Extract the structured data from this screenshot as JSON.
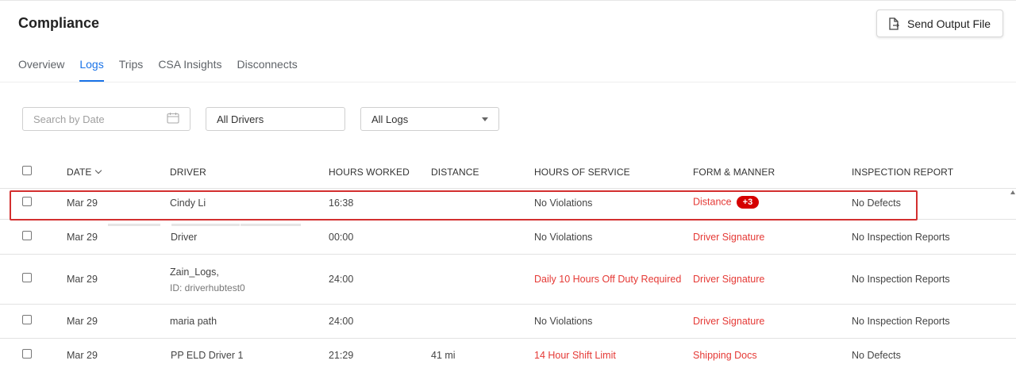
{
  "page": {
    "title": "Compliance",
    "send_button_label": "Send Output File"
  },
  "tabs": [
    {
      "label": "Overview",
      "active": false
    },
    {
      "label": "Logs",
      "active": true
    },
    {
      "label": "Trips",
      "active": false
    },
    {
      "label": "CSA Insights",
      "active": false
    },
    {
      "label": "Disconnects",
      "active": false
    }
  ],
  "filters": {
    "date_placeholder": "Search by Date",
    "drivers_value": "All Drivers",
    "logs_value": "All Logs"
  },
  "table": {
    "headers": {
      "date": "DATE",
      "driver": "DRIVER",
      "hours_worked": "HOURS WORKED",
      "distance": "DISTANCE",
      "hours_of_service": "HOURS OF SERVICE",
      "form_manner": "FORM & MANNER",
      "inspection_report": "INSPECTION REPORT"
    },
    "rows": [
      {
        "date": "Mar 29",
        "driver": "Cindy Li",
        "driver_sub": "",
        "hours": "16:38",
        "distance": "",
        "hos": "No Violations",
        "form": "Distance",
        "form_badge": "+3",
        "inspection": "No Defects"
      },
      {
        "date": "Mar 29",
        "driver": "Driver",
        "driver_sub": "",
        "hours": "00:00",
        "distance": "",
        "hos": "No Violations",
        "form": "Driver Signature",
        "form_badge": "",
        "inspection": "No Inspection Reports"
      },
      {
        "date": "Mar 29",
        "driver": "Zain_Logs,",
        "driver_sub": "ID: driverhubtest0",
        "hours": "24:00",
        "distance": "",
        "hos": "Daily 10 Hours Off Duty Required",
        "form": "Driver Signature",
        "form_badge": "",
        "inspection": "No Inspection Reports"
      },
      {
        "date": "Mar 29",
        "driver": "maria path",
        "driver_sub": "",
        "hours": "24:00",
        "distance": "",
        "hos": "No Violations",
        "form": "Driver Signature",
        "form_badge": "",
        "inspection": "No Inspection Reports"
      },
      {
        "date": "Mar 29",
        "driver": "PP ELD Driver 1",
        "driver_sub": "",
        "hours": "21:29",
        "distance": "41 mi",
        "hos": "14 Hour Shift Limit",
        "form": "Shipping Docs",
        "form_badge": "",
        "inspection": "No Defects"
      }
    ]
  },
  "colors": {
    "accent": "#1a73e8",
    "violation": "#e53935",
    "badge": "#d50000",
    "highlight": "#d32f2f"
  }
}
